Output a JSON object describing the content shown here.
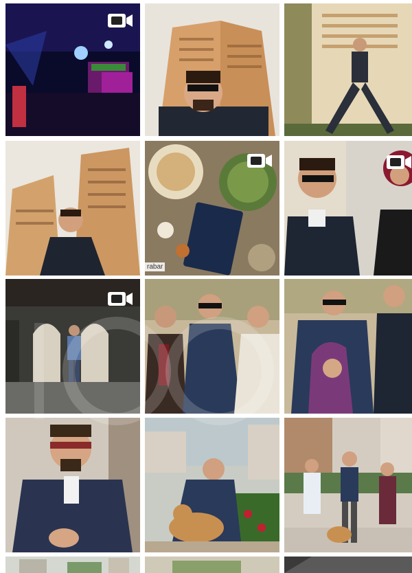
{
  "feed": {
    "columns": 3,
    "rows_visible": 5,
    "tiles": [
      {
        "id": "r1c1",
        "scene": "nightclub",
        "video": true,
        "caption": ""
      },
      {
        "id": "r1c2",
        "scene": "man-sunglasses-building",
        "video": false,
        "caption": ""
      },
      {
        "id": "r1c3",
        "scene": "man-posing-wall",
        "video": false,
        "caption": ""
      },
      {
        "id": "r2c1",
        "scene": "man-tower-lowangle",
        "video": false,
        "caption": ""
      },
      {
        "id": "r2c2",
        "scene": "food-table-book",
        "video": true,
        "caption": "rabar"
      },
      {
        "id": "r2c3",
        "scene": "man-and-woman",
        "video": true,
        "caption": ""
      },
      {
        "id": "r3c1",
        "scene": "arcade-walk",
        "video": true,
        "caption": ""
      },
      {
        "id": "r3c2",
        "scene": "three-men",
        "video": false,
        "caption": ""
      },
      {
        "id": "r3c3",
        "scene": "couple-group",
        "video": false,
        "caption": ""
      },
      {
        "id": "r4c1",
        "scene": "man-closeup",
        "video": false,
        "caption": ""
      },
      {
        "id": "r4c2",
        "scene": "man-with-dog",
        "video": false,
        "caption": ""
      },
      {
        "id": "r4c3",
        "scene": "group-with-dog",
        "video": false,
        "caption": ""
      },
      {
        "id": "r5c1",
        "scene": "partial",
        "video": false,
        "caption": ""
      },
      {
        "id": "r5c2",
        "scene": "partial",
        "video": false,
        "caption": ""
      },
      {
        "id": "r5c3",
        "scene": "partial",
        "video": false,
        "caption": ""
      }
    ]
  },
  "icons": {
    "video": "video-camera-icon"
  },
  "colors": {
    "background": "#ffffff",
    "badge": "#ffffff"
  }
}
